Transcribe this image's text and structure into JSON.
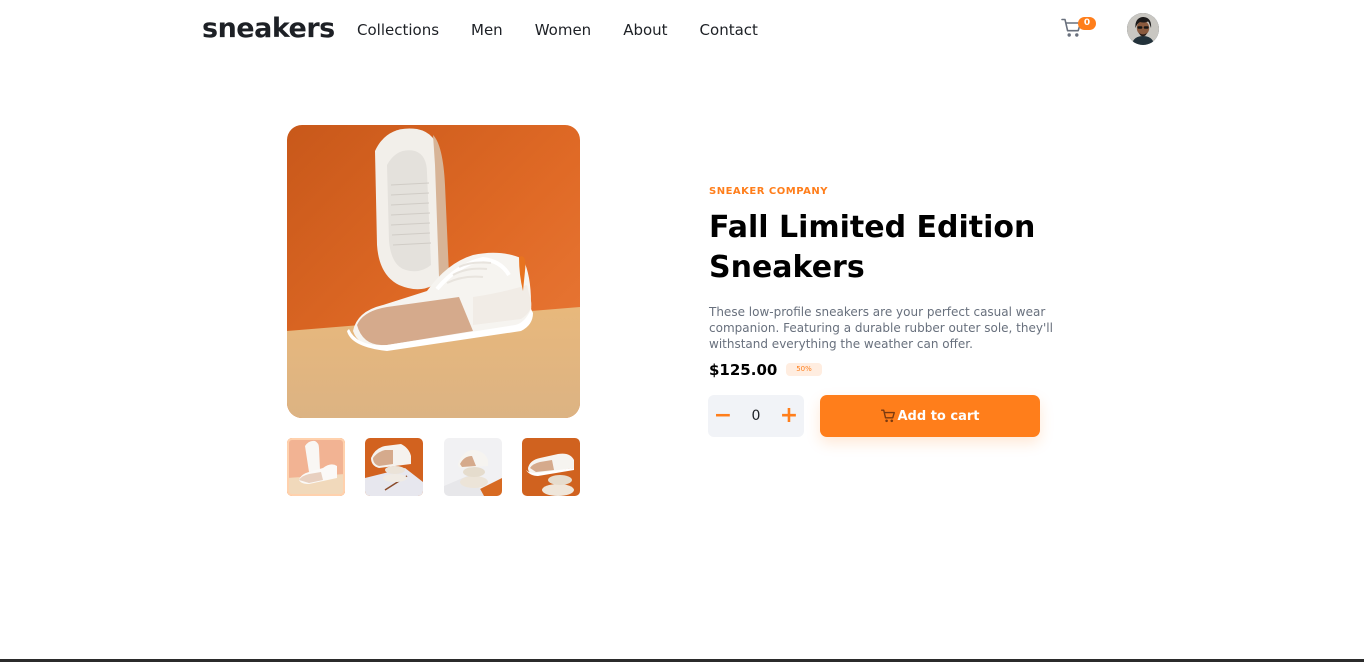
{
  "header": {
    "logo": "sneakers",
    "nav": [
      "Collections",
      "Men",
      "Women",
      "About",
      "Contact"
    ],
    "cart_count": "0",
    "cart_icon": "cart-icon",
    "avatar": "user-avatar"
  },
  "gallery": {
    "main_alt": "sneaker-main-image",
    "thumbnails": [
      "thumbnail-1",
      "thumbnail-2",
      "thumbnail-3",
      "thumbnail-4"
    ],
    "active_index": 0
  },
  "product": {
    "company": "Sneaker Company",
    "title": "Fall Limited Edition Sneakers",
    "description": "These low-profile sneakers are your perfect casual wear companion. Featuring a durable rubber outer sole, they'll withstand everything the weather can offer.",
    "price": "$125.00",
    "discount": "50%"
  },
  "cart_controls": {
    "minus": "−",
    "quantity": "0",
    "plus": "+",
    "add_label": "Add to cart"
  },
  "colors": {
    "accent": "#ff7e1b",
    "accent_pale": "#ffede0",
    "text_dark": "#1d2025",
    "text_gray": "#68707d",
    "qty_bg": "#f1f3f7"
  }
}
